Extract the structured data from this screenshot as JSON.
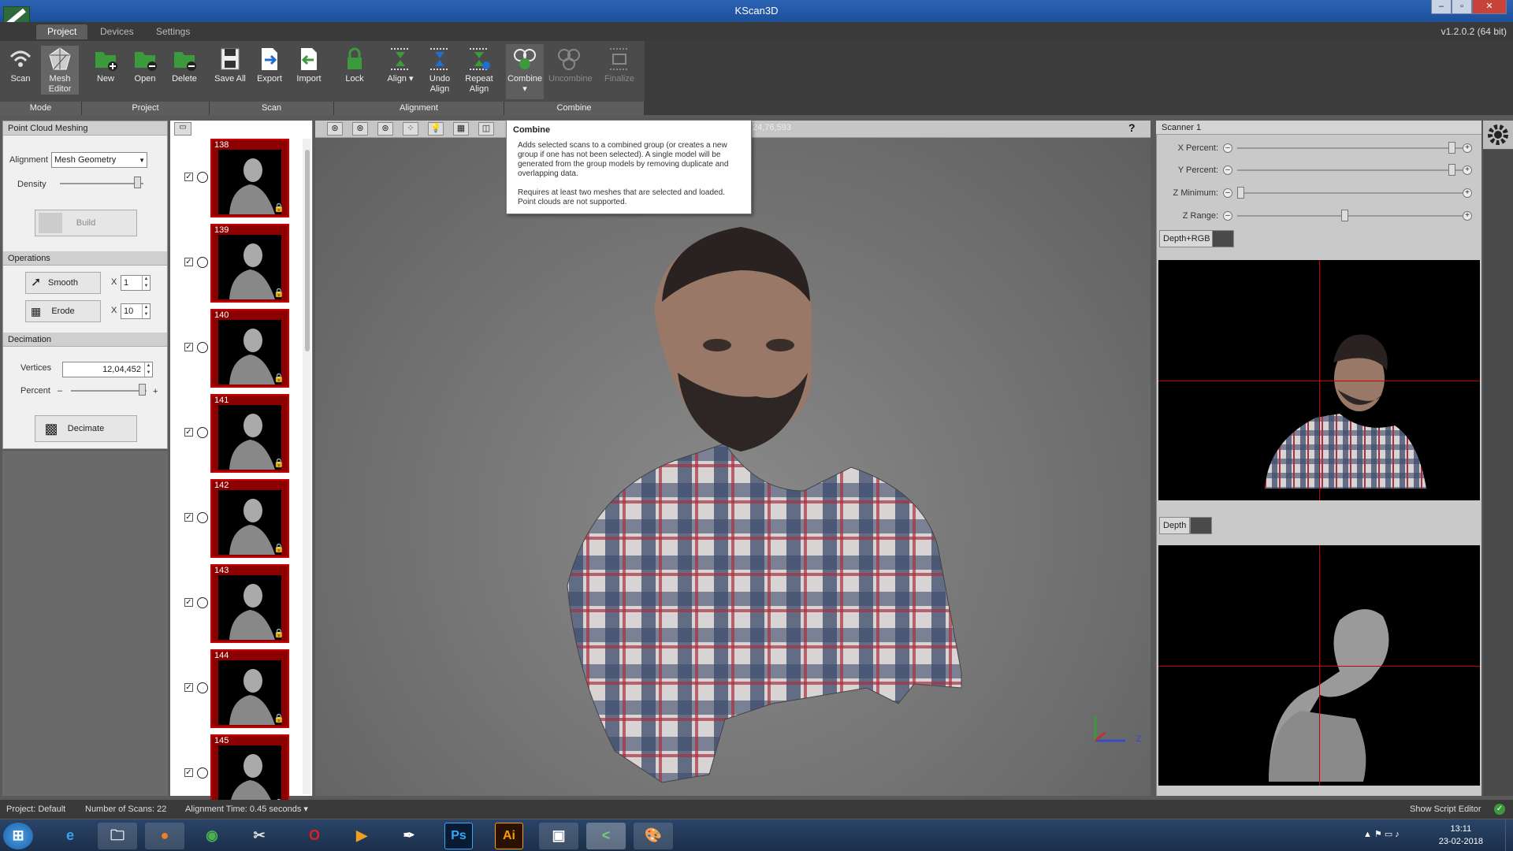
{
  "window": {
    "title": "KScan3D",
    "version": "v1.2.0.2  (64 bit)"
  },
  "ribbon_tabs": [
    "Project",
    "Devices",
    "Settings"
  ],
  "toolbar": {
    "scan": "Scan",
    "mesh_editor": "Mesh Editor",
    "new": "New",
    "open": "Open",
    "delete": "Delete",
    "save_all": "Save All",
    "export": "Export",
    "import": "Import",
    "lock": "Lock",
    "align": "Align",
    "undo_align": "Undo Align",
    "repeat_align": "Repeat Align",
    "combine": "Combine",
    "uncombine": "Uncombine",
    "finalize": "Finalize"
  },
  "groups": [
    "Mode",
    "Project",
    "Scan",
    "Alignment",
    "Combine"
  ],
  "left_panel": {
    "point_cloud_title": "Point Cloud Meshing",
    "alignment_label": "Alignment",
    "alignment_value": "Mesh Geometry",
    "density_label": "Density",
    "build_label": "Build",
    "operations_title": "Operations",
    "smooth_label": "Smooth",
    "smooth_x": "X",
    "smooth_value": "1",
    "erode_label": "Erode",
    "erode_x": "X",
    "erode_value": "10",
    "decimation_title": "Decimation",
    "vertices_label": "Vertices",
    "vertices_value": "12,04,452",
    "percent_label": "Percent",
    "percent_minus": "–",
    "percent_plus": "+",
    "decimate_label": "Decimate"
  },
  "scans": [
    "138",
    "139",
    "140",
    "141",
    "142",
    "143",
    "144",
    "145"
  ],
  "viewport": {
    "coords": "24,76,593",
    "help": "?",
    "axis_z": "Z"
  },
  "tooltip": {
    "title": "Combine",
    "p1": "Adds selected scans to a combined group (or creates a new group if one has not been selected).  A single model will be generated from the group models by removing duplicate and overlapping data.",
    "p2": "Requires at least two meshes that are selected and loaded. Point clouds are not supported."
  },
  "scanner": {
    "title": "Scanner 1",
    "x_percent": "X Percent:",
    "y_percent": "Y Percent:",
    "z_minimum": "Z Minimum:",
    "z_range": "Z Range:",
    "tab_depth_rgb": "Depth+RGB",
    "tab_depth": "Depth"
  },
  "status": {
    "project": "Project:  Default",
    "num_scans": "Number of Scans:  22",
    "align_time": "Alignment Time:  0.45 seconds ▾",
    "script_editor": "Show Script Editor"
  },
  "clock": {
    "time": "13:11",
    "date": "23-02-2018"
  },
  "taskbar_labels": {
    "ps": "Ps",
    "ai": "Ai"
  }
}
